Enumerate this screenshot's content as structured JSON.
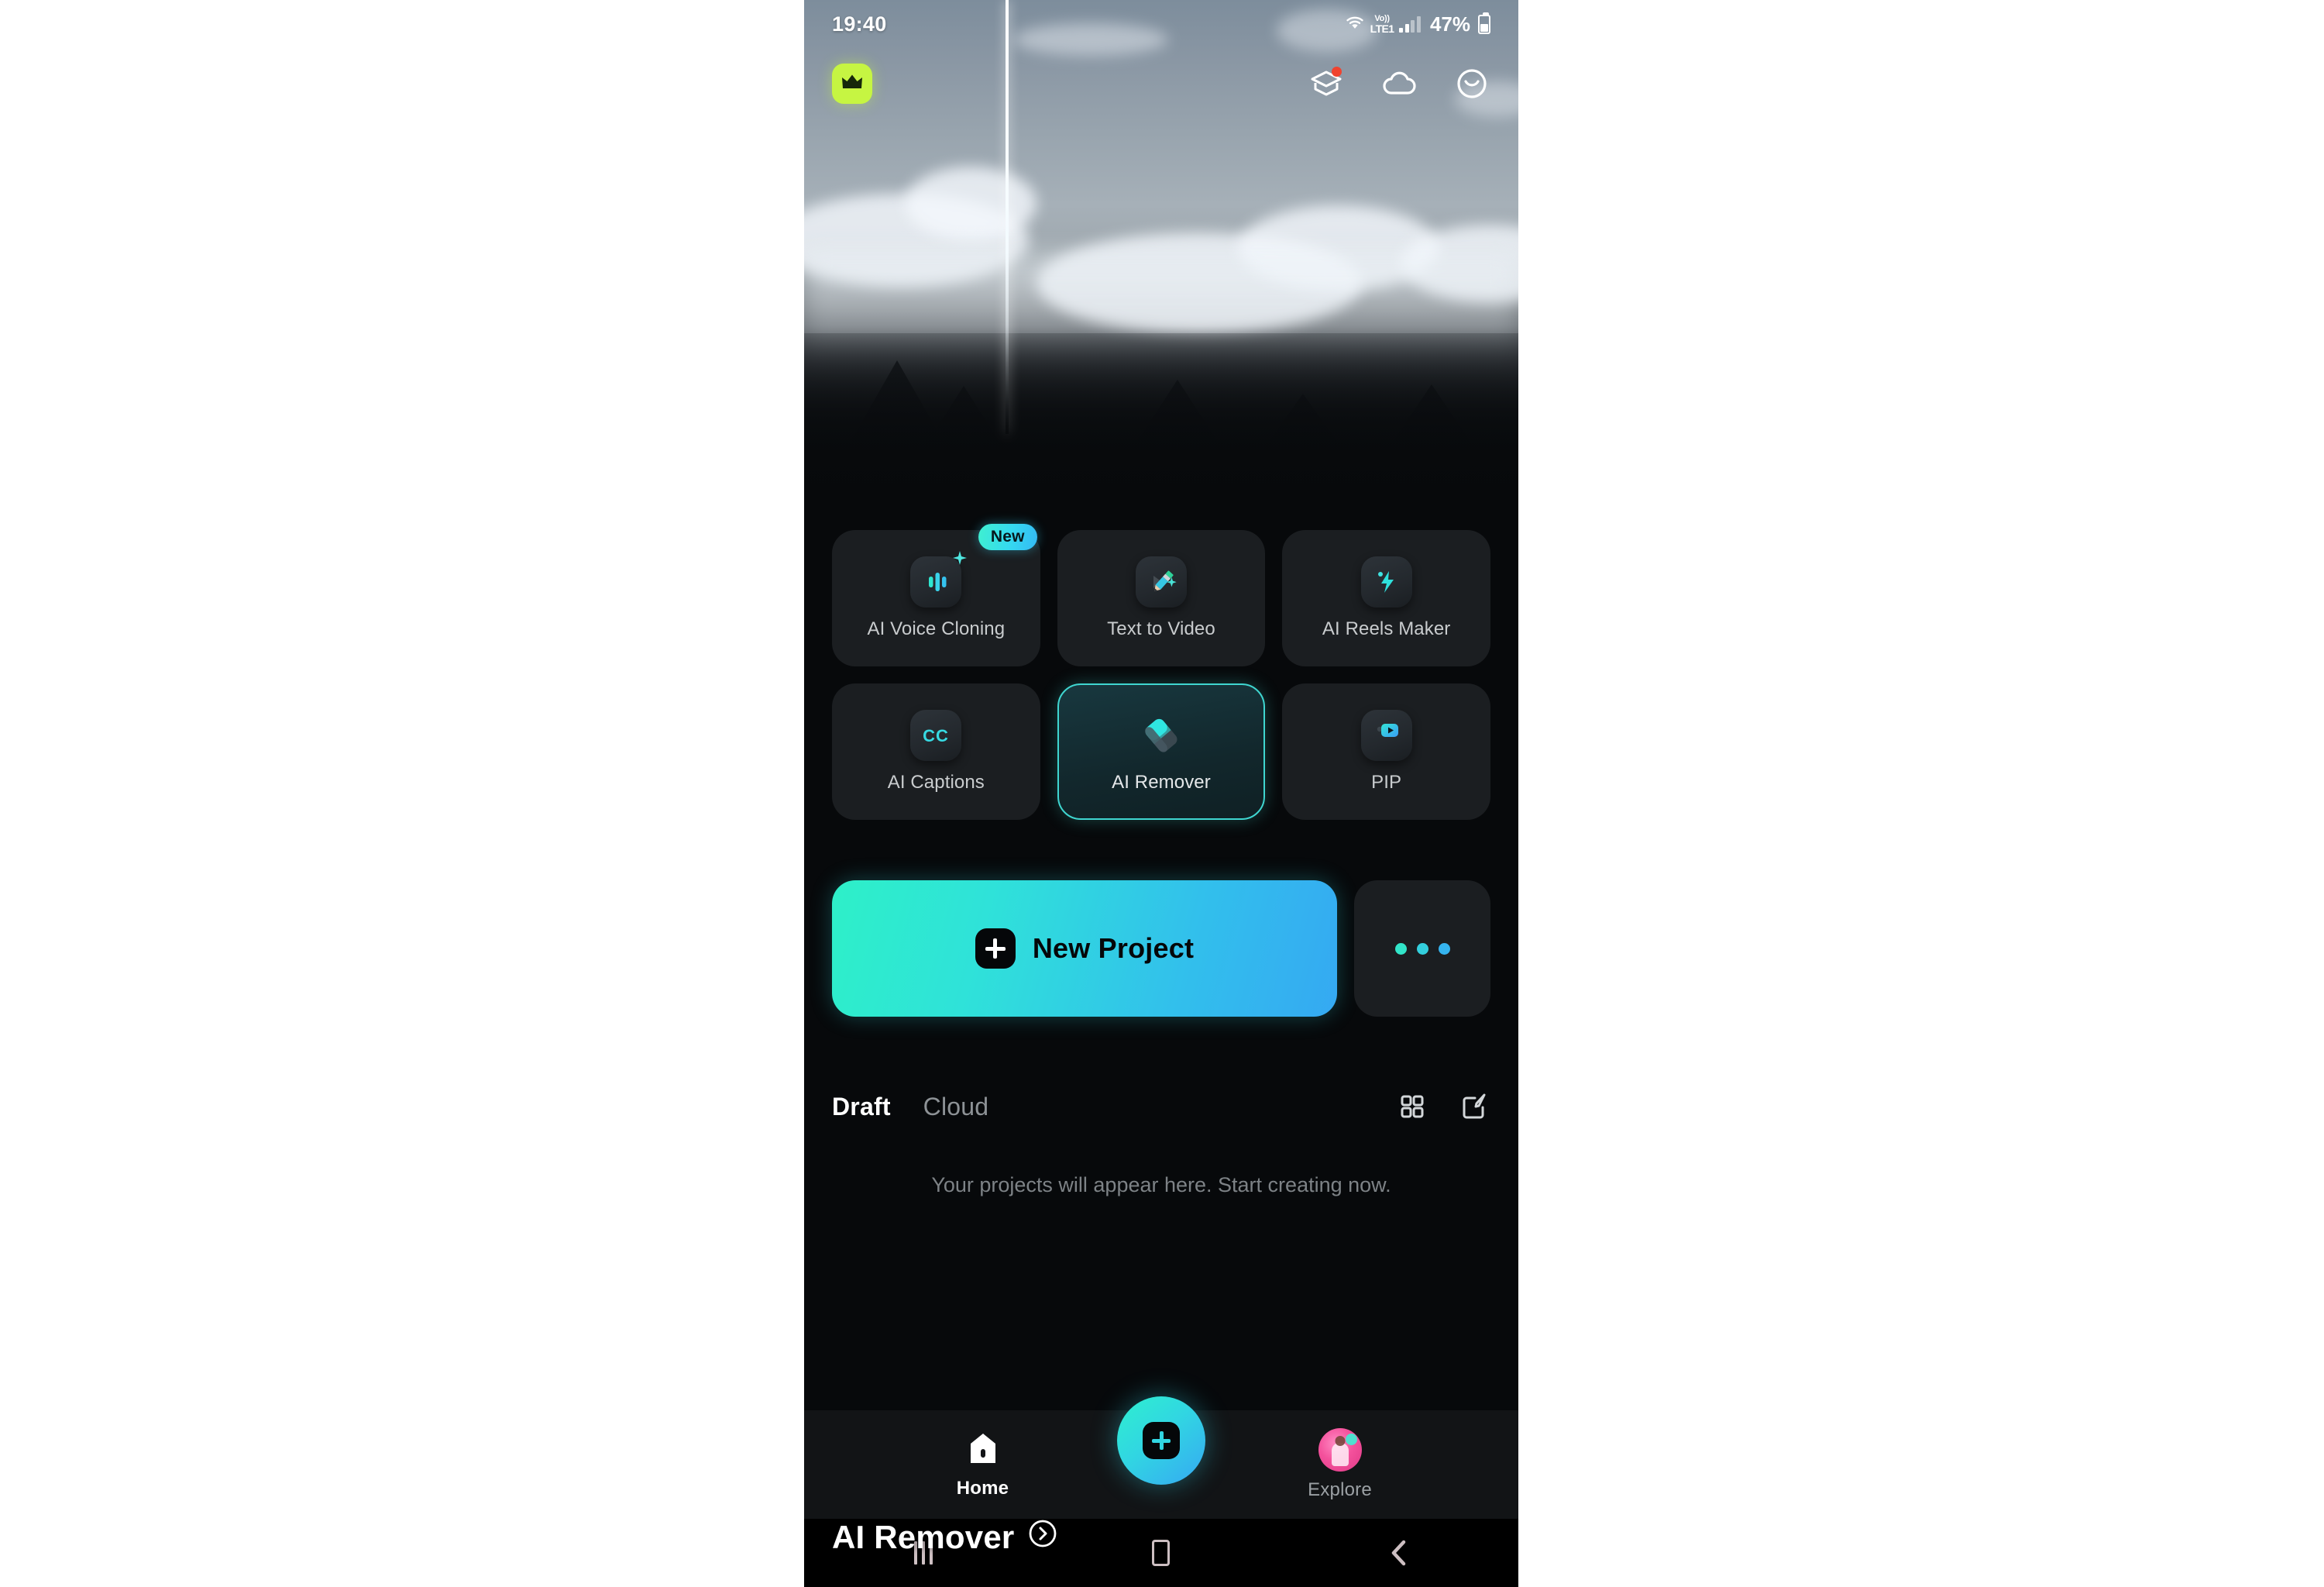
{
  "status_bar": {
    "time": "19:40",
    "volte_top": "Vo))",
    "volte_bottom": "LTE1",
    "battery_pct": "47%",
    "wifi_icon": "wifi-icon",
    "signal_icon": "signal-bars-icon",
    "battery_icon": "battery-icon"
  },
  "hero": {
    "title": "AI Remover",
    "arrow_icon": "chevron-right-circle-icon",
    "crown_icon": "crown-icon",
    "actions": [
      {
        "name": "tutorial",
        "icon": "graduation-cap-icon",
        "badge": true
      },
      {
        "name": "cloud",
        "icon": "cloud-icon",
        "badge": false
      },
      {
        "name": "profile",
        "icon": "smiley-face-icon",
        "badge": false
      }
    ]
  },
  "features": {
    "tiles": [
      {
        "label": "AI Voice Cloning",
        "icon": "voice-waveform-icon",
        "badge": "New",
        "active": false
      },
      {
        "label": "Text to Video",
        "icon": "pencil-video-icon",
        "badge": "",
        "active": false
      },
      {
        "label": "AI Reels Maker",
        "icon": "lightning-bolt-icon",
        "badge": "",
        "active": false
      },
      {
        "label": "AI Captions",
        "icon": "cc-icon",
        "badge": "",
        "active": false
      },
      {
        "label": "AI Remover",
        "icon": "eraser-icon",
        "badge": "",
        "active": true
      },
      {
        "label": "PIP",
        "icon": "picture-in-picture-icon",
        "badge": "",
        "active": false
      }
    ]
  },
  "actions": {
    "new_project_label": "New Project",
    "new_project_icon": "plus-icon",
    "more_icon": "more-dots-icon"
  },
  "project_tabs": {
    "tabs": [
      {
        "label": "Draft",
        "active": true
      },
      {
        "label": "Cloud",
        "active": false
      }
    ],
    "grid_icon": "grid-view-icon",
    "edit_icon": "edit-square-icon"
  },
  "empty_state": {
    "message": "Your projects will appear here. Start creating now."
  },
  "bottom_nav": {
    "items": [
      {
        "label": "Home",
        "icon": "home-icon",
        "active": true
      },
      {
        "label": "Explore",
        "icon": "avatar-thumbnail",
        "active": false
      }
    ],
    "fab_icon": "plus-icon"
  },
  "android_nav": {
    "recents_icon": "recents-icon",
    "home_icon": "home-square-icon",
    "back_icon": "back-chevron-icon"
  },
  "colors": {
    "accent_cyan": "#2ef0c8",
    "accent_blue": "#35a9f2",
    "premium_green": "#c6f542",
    "badge_red": "#f0432f",
    "surface": "#1b1e21",
    "background": "#07090b"
  }
}
